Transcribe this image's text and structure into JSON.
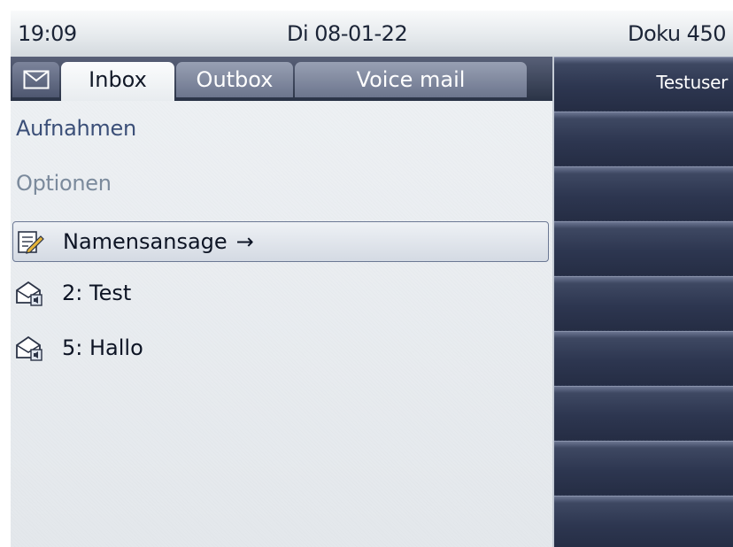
{
  "status_bar": {
    "time": "19:09",
    "date": "Di 08-01-22",
    "user_name": "Doku 450"
  },
  "tabs": [
    {
      "label": "Inbox",
      "selected": true
    },
    {
      "label": "Outbox",
      "selected": false
    },
    {
      "label": "Voice mail",
      "selected": false
    }
  ],
  "menu": {
    "recordings": "Aufnahmen",
    "options": "Optionen",
    "name_announcement": "Namensansage",
    "name_announcement_arrow": "→",
    "messages": [
      "2: Test",
      "5: Hallo"
    ]
  },
  "function_keys": {
    "key_1_label": "Testuser"
  },
  "icons": {
    "tab": "envelope-icon",
    "name_announcement": "note-edit-icon",
    "message": "voicemail-envelope-icon"
  },
  "colors": {
    "status_bar_text": "#1b2436",
    "link_text": "#3b4f78",
    "disabled_text": "#7b8a9c",
    "panel_dark": "#2c3650"
  }
}
